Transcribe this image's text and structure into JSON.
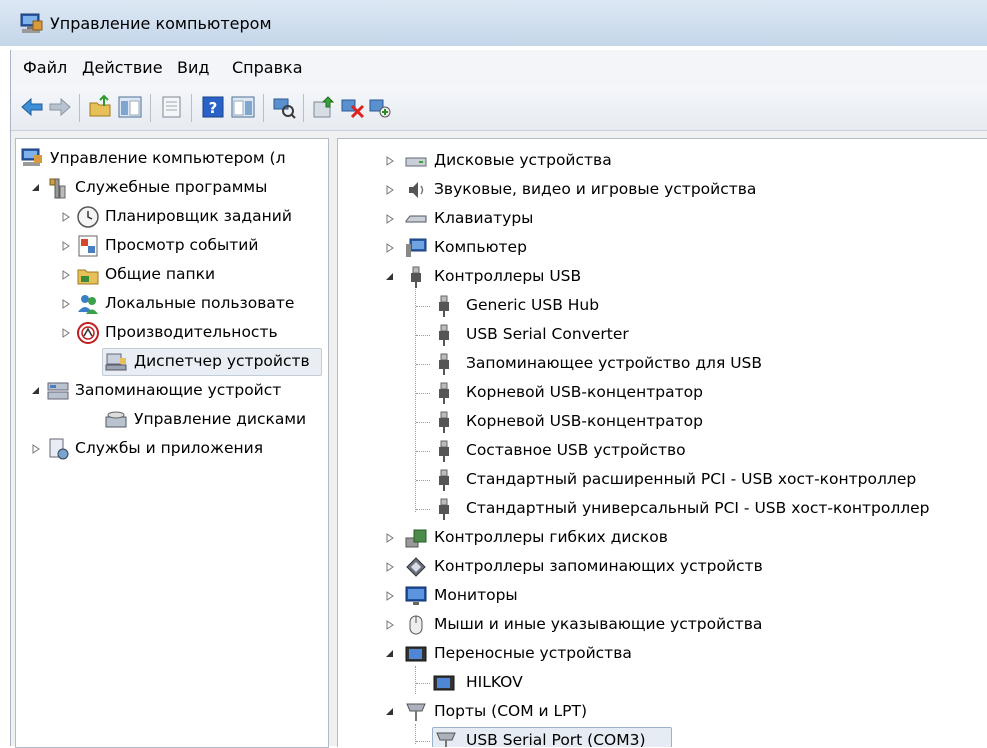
{
  "window": {
    "title": "Управление компьютером"
  },
  "menu": {
    "file": "Файл",
    "action": "Действие",
    "view": "Вид",
    "help": "Справка"
  },
  "tree": {
    "root": "Управление компьютером (л",
    "tools": "Служебные программы",
    "scheduler": "Планировщик заданий",
    "events": "Просмотр событий",
    "shared": "Общие папки",
    "users": "Локальные пользовате",
    "perf": "Производительность",
    "devmgr": "Диспетчер устройств",
    "storage": "Запоминающие устройст",
    "diskmgmt": "Управление дисками",
    "services": "Службы и приложения"
  },
  "devices": {
    "disks": "Дисковые устройства",
    "sound": "Звуковые, видео и игровые устройства",
    "keyboards": "Клавиатуры",
    "computer": "Компьютер",
    "usb": "Контроллеры USB",
    "usb_children": [
      "Generic USB Hub",
      "USB Serial Converter",
      "Запоминающее устройство для USB",
      "Корневой USB-концентратор",
      "Корневой USB-концентратор",
      "Составное USB устройство",
      "Стандартный расширенный PCI - USB хост-контроллер",
      "Стандартный универсальный PCI - USB хост-контроллер"
    ],
    "floppy": "Контроллеры гибких дисков",
    "storage_ctrl": "Контроллеры запоминающих устройств",
    "monitors": "Мониторы",
    "mice": "Мыши и иные указывающие устройства",
    "portable": "Переносные устройства",
    "portable_child": "HILKOV",
    "ports": "Порты (COM и LPT)",
    "ports_child": "USB Serial Port (COM3)"
  }
}
